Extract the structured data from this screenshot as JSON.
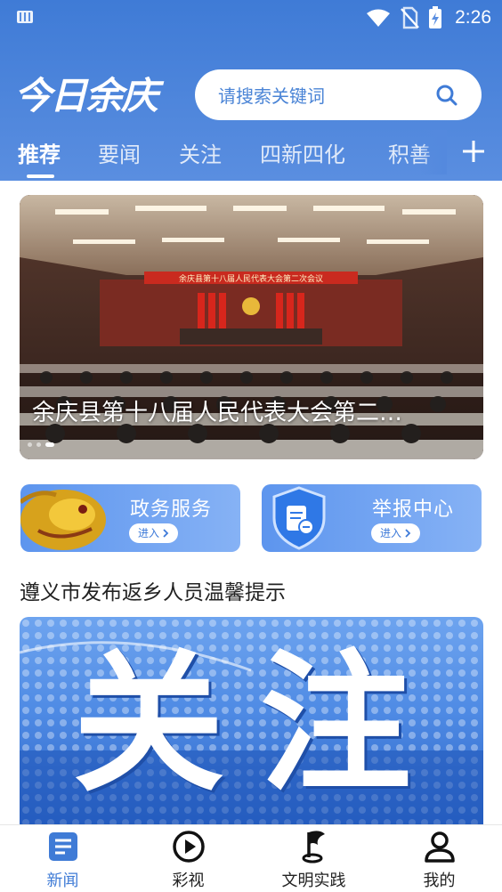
{
  "status": {
    "time": "2:26"
  },
  "header": {
    "logo_text": "今日余庆",
    "search": {
      "placeholder": "请搜索关键词"
    },
    "tabs": [
      {
        "label": "推荐",
        "active": true
      },
      {
        "label": "要闻",
        "active": false
      },
      {
        "label": "关注",
        "active": false
      },
      {
        "label": "四新四化",
        "active": false
      },
      {
        "label": "积善",
        "active": false
      }
    ]
  },
  "banner": {
    "title": "余庆县第十八届人民代表大会第二…",
    "stage_banner": "余庆县第十八届人民代表大会第二次会议",
    "slide_count": 3,
    "active_slide": 3
  },
  "services": [
    {
      "title": "政务服务",
      "enter_label": "进入"
    },
    {
      "title": "举报中心",
      "enter_label": "进入"
    }
  ],
  "news": {
    "headline": "遵义市发布返乡人员温馨提示",
    "feature_text": "关注"
  },
  "bottom_nav": [
    {
      "label": "新闻",
      "icon": "news-icon",
      "active": true
    },
    {
      "label": "彩视",
      "icon": "play-icon",
      "active": false
    },
    {
      "label": "文明实践",
      "icon": "flag-icon",
      "active": false
    },
    {
      "label": "我的",
      "icon": "user-icon",
      "active": false
    }
  ],
  "colors": {
    "primary": "#3f7bd6",
    "header_bottom": "#5a8ee0"
  }
}
